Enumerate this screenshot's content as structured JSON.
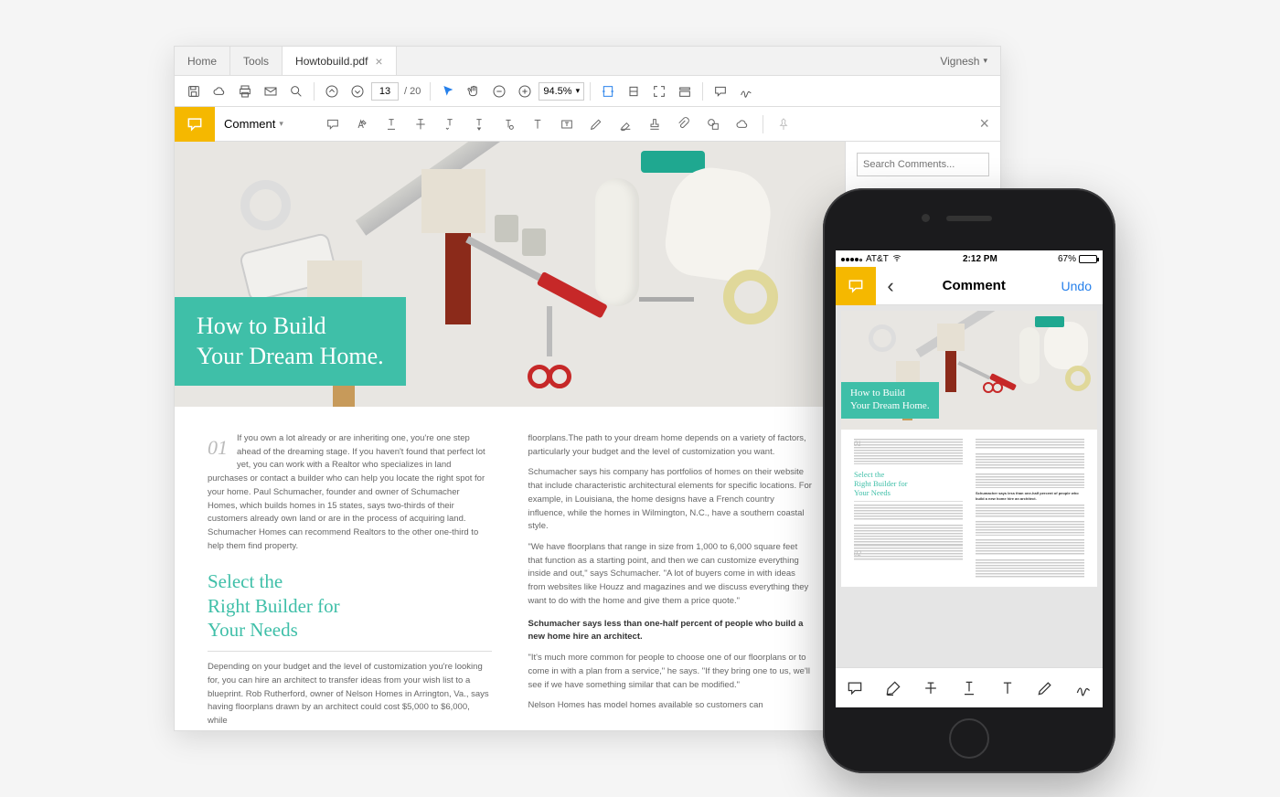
{
  "desktop": {
    "tabs": {
      "home": "Home",
      "tools": "Tools",
      "file": "Howtobuild.pdf"
    },
    "user": "Vignesh",
    "page": {
      "current": "13",
      "total": "/ 20"
    },
    "zoom": "94.5%",
    "comment_label": "Comment",
    "search_placeholder": "Search Comments..."
  },
  "document": {
    "hero_title_line1": "How to Build",
    "hero_title_line2": "Your Dream Home.",
    "section_number": "01",
    "intro": "If you own a lot already or are inheriting one, you're one step ahead of the dreaming stage. If you haven't found that perfect lot yet, you can work with a Realtor who specializes in land purchases or contact a builder who can help you locate the right spot for your home. Paul Schumacher, founder and owner of Schumacher Homes, which builds homes in 15 states, says two-thirds of their customers already own land or are in the process of acquiring land. Schumacher Homes can recommend Realtors to the other one-third to help them find property.",
    "subhead": "Select the\nRight Builder for\nYour Needs",
    "p2": "Depending on your budget and the level of customization you're looking for, you can hire an architect to transfer ideas from your wish list to a blueprint. Rob Rutherford, owner of Nelson Homes in Arrington, Va., says having floorplans drawn by an architect could cost $5,000 to $6,000, while",
    "col2_p1": "floorplans.The path to your dream home depends on a variety of factors, particularly your budget and the level of customization you want.",
    "col2_p2": "Schumacher says his company has portfolios of homes on their website that include characteristic architectural elements for specific locations. For example, in Louisiana, the home designs have a French country influence, while the homes in Wilmington, N.C., have a southern coastal style.",
    "col2_p3": "\"We have floorplans that range in size from 1,000 to 6,000 square feet that function as a starting point, and then we can customize everything inside and out,\" says Schumacher. \"A lot of buyers come in with ideas from websites like Houzz and magazines and we discuss everything they want to do with the home and give them a price quote.\"",
    "col2_bold": "Schumacher says less than one-half percent of people who build a new home hire an architect.",
    "col2_p4": "\"It's much more common for people to choose one of our floorplans or to come in with a plan from a service,\" he says. \"If they bring one to us, we'll see if we have something similar that can be modified.\"",
    "col2_p5": "Nelson Homes has model homes available so customers can"
  },
  "phone": {
    "status": {
      "carrier": "AT&T",
      "time": "2:12 PM",
      "battery": "67%"
    },
    "header": {
      "title": "Comment",
      "undo": "Undo"
    },
    "doc": {
      "hero_line1": "How to Build",
      "hero_line2": "Your Dream Home.",
      "num1": "01",
      "num2": "02",
      "subhead": "Select the\nRight Builder for\nYour Needs",
      "bold": "Schumacher says less than one-half percent of people who build a new home hire an architect."
    }
  }
}
